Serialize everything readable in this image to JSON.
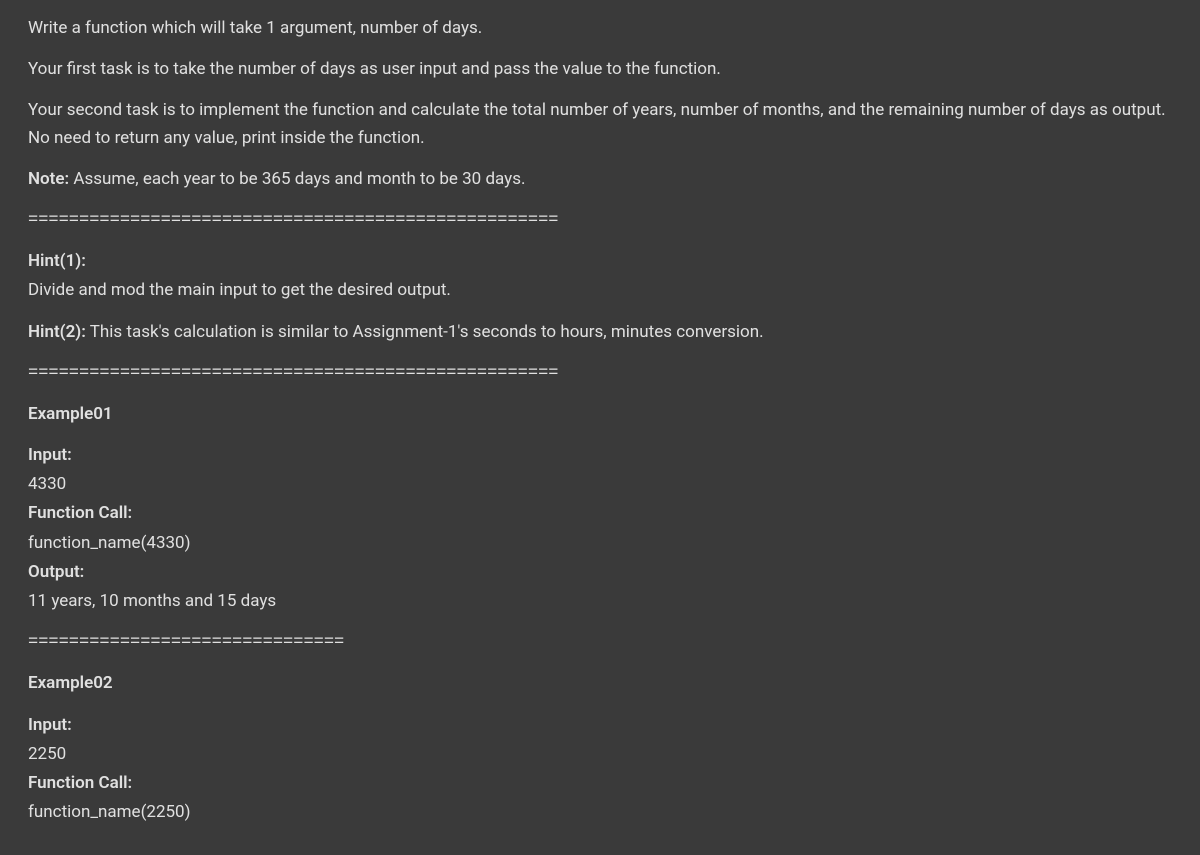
{
  "intro": {
    "line1": "Write a function which will take 1 argument, number of days.",
    "line2": "Your first task is to take the number of days as user input and pass the value to the function.",
    "line3": "Your second task is to implement the function and calculate the total number of years, number of months, and the remaining number of days as output. No need to return any value, print inside the function."
  },
  "note": {
    "label": "Note:",
    "text": " Assume, each year to be 365 days and month to be 30 days."
  },
  "divider_long": "====================================================",
  "divider_short": "===============================",
  "hint1": {
    "label": "Hint(1):",
    "text": "Divide and mod the main input to get the desired output."
  },
  "hint2": {
    "label": "Hint(2):",
    "text": " This task's calculation is similar to Assignment-1's seconds to hours, minutes conversion."
  },
  "example1": {
    "title": "Example01",
    "input_label": "Input:",
    "input_value": "4330",
    "function_call_label": "Function Call:",
    "function_call_value": "function_name(4330)",
    "output_label": "Output:",
    "output_value": "11 years, 10 months and 15 days"
  },
  "example2": {
    "title": "Example02",
    "input_label": "Input:",
    "input_value": "2250",
    "function_call_label": "Function Call:",
    "function_call_value": "function_name(2250)"
  }
}
